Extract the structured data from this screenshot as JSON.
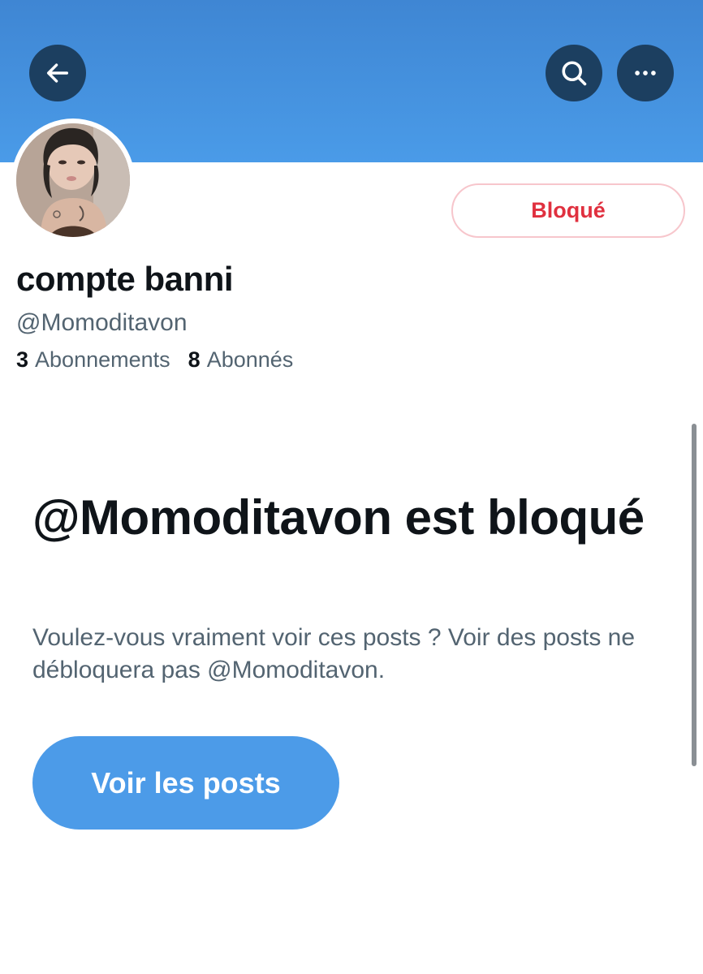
{
  "header": {
    "back_icon": "arrow-left-icon",
    "search_icon": "search-icon",
    "more_icon": "more-horizontal-icon",
    "banner_color": "#4a9be8"
  },
  "profile": {
    "display_name": "compte banni",
    "handle": "@Momoditavon",
    "following_count": "3",
    "following_label": "Abonnements",
    "followers_count": "8",
    "followers_label": "Abonnés",
    "blocked_button_label": "Bloqué",
    "blocked_color": "#e0303f"
  },
  "blocked_notice": {
    "title": "@Momoditavon est bloqué",
    "description": "Voulez-vous vraiment voir ces posts ? Voir des posts ne débloquera pas @Momoditavon.",
    "button_label": "Voir les posts",
    "button_color": "#4c9be8"
  }
}
